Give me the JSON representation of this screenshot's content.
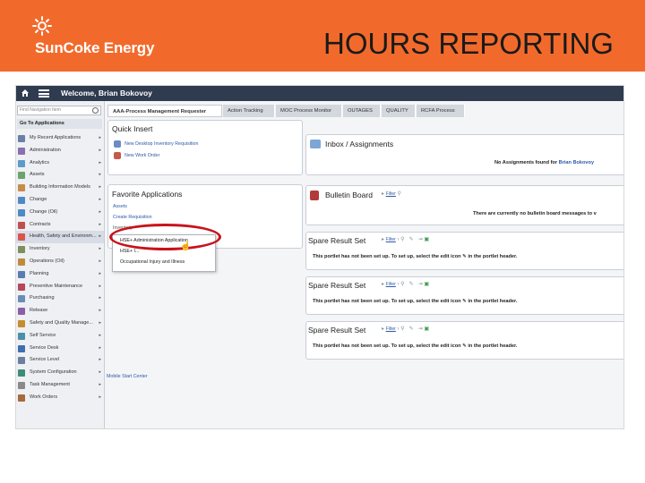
{
  "slide": {
    "brand": "SunCoke Energy",
    "title": "HOURS REPORTING",
    "banner_color": "#f26a2b"
  },
  "app": {
    "welcome": "Welcome, Brian Bokovoy",
    "nav_search_placeholder": "Find Navigation Item",
    "go_to_applications": "Go To Applications",
    "nav_items": [
      "My Recent Applications",
      "Administration",
      "Analytics",
      "Assets",
      "Building Information Models",
      "Change",
      "Change (Oil)",
      "Contracts",
      "Health, Safety and Environm...",
      "Inventory",
      "Operations (Oil)",
      "Planning",
      "Preventive Maintenance",
      "Purchasing",
      "Release",
      "Safety and Quality Manage...",
      "Self Service",
      "Service Desk",
      "Service Level",
      "System Configuration",
      "Task Management",
      "Work Orders"
    ],
    "tabs": [
      "AAA-Process Management Requester",
      "Action Tracking",
      "MOC Process Monitor",
      "OUTAGES",
      "QUALITY",
      "RCFA Process"
    ],
    "quick_insert": {
      "title": "Quick Insert",
      "items": [
        "New Desktop Inventory Requisition",
        "New Work Order"
      ]
    },
    "favorite_apps": {
      "title": "Favorite Applications",
      "items": [
        "Assets",
        "Create Requisition",
        "Inventory"
      ],
      "dropdown_items": [
        "HSE+ Administration Application",
        "HSE+ I...",
        "Occupational Injury and Illness"
      ]
    },
    "mobile_link": "Mobile Start Center",
    "inbox": {
      "title": "Inbox / Assignments",
      "message": "No Assignments found for",
      "user": "Brian Bokovoy"
    },
    "bulletin": {
      "title": "Bulletin Board",
      "filter": "Filter",
      "message": "There are currently no bulletin board messages to v"
    },
    "result_sets": [
      {
        "title": "Spare Result Set",
        "filter": "Filter",
        "message": "This portlet has not been set up. To set up, select the edit icon",
        "suffix": "in the portlet header."
      },
      {
        "title": "Spare Result Set",
        "filter": "Filter",
        "message": "This portlet has not been set up. To set up, select the edit icon",
        "suffix": "in the portlet header."
      },
      {
        "title": "Spare Result Set",
        "filter": "Filter",
        "message": "This portlet has not been set up. To set up, select the edit icon",
        "suffix": "in the portlet header."
      }
    ]
  }
}
